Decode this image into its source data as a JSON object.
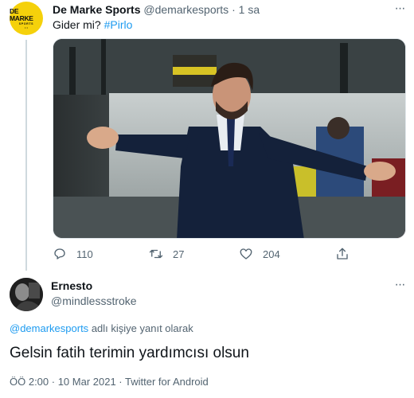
{
  "tweet": {
    "avatar_logo": "DE MARKE",
    "avatar_logo_sub": "SPORTS",
    "author_name": "De Marke Sports",
    "author_handle": "@demarkesports",
    "separator": "·",
    "time": "1 sa",
    "text": "Gider mi?",
    "hashtag": "#Pirlo",
    "media_icon": "photo-coach-gesturing",
    "more_icon": "ellipsis-icon",
    "actions": {
      "reply_count": "110",
      "retweet_count": "27",
      "like_count": "204"
    }
  },
  "reply": {
    "author_name": "Ernesto",
    "author_handle": "@mindlessstroke",
    "reply_to_mention": "@demarkesports",
    "reply_to_suffix": "adlı kişiye yanıt olarak",
    "text": "Gelsin fatih terimin yardımcısı olsun",
    "meta": "ÖÖ 2:00 · 10 Mar 2021 · Twitter for Android"
  },
  "colors": {
    "accent": "#1d9bf0",
    "muted": "#536471",
    "text": "#0f1419",
    "avatar_brand": "#f5d10b"
  }
}
